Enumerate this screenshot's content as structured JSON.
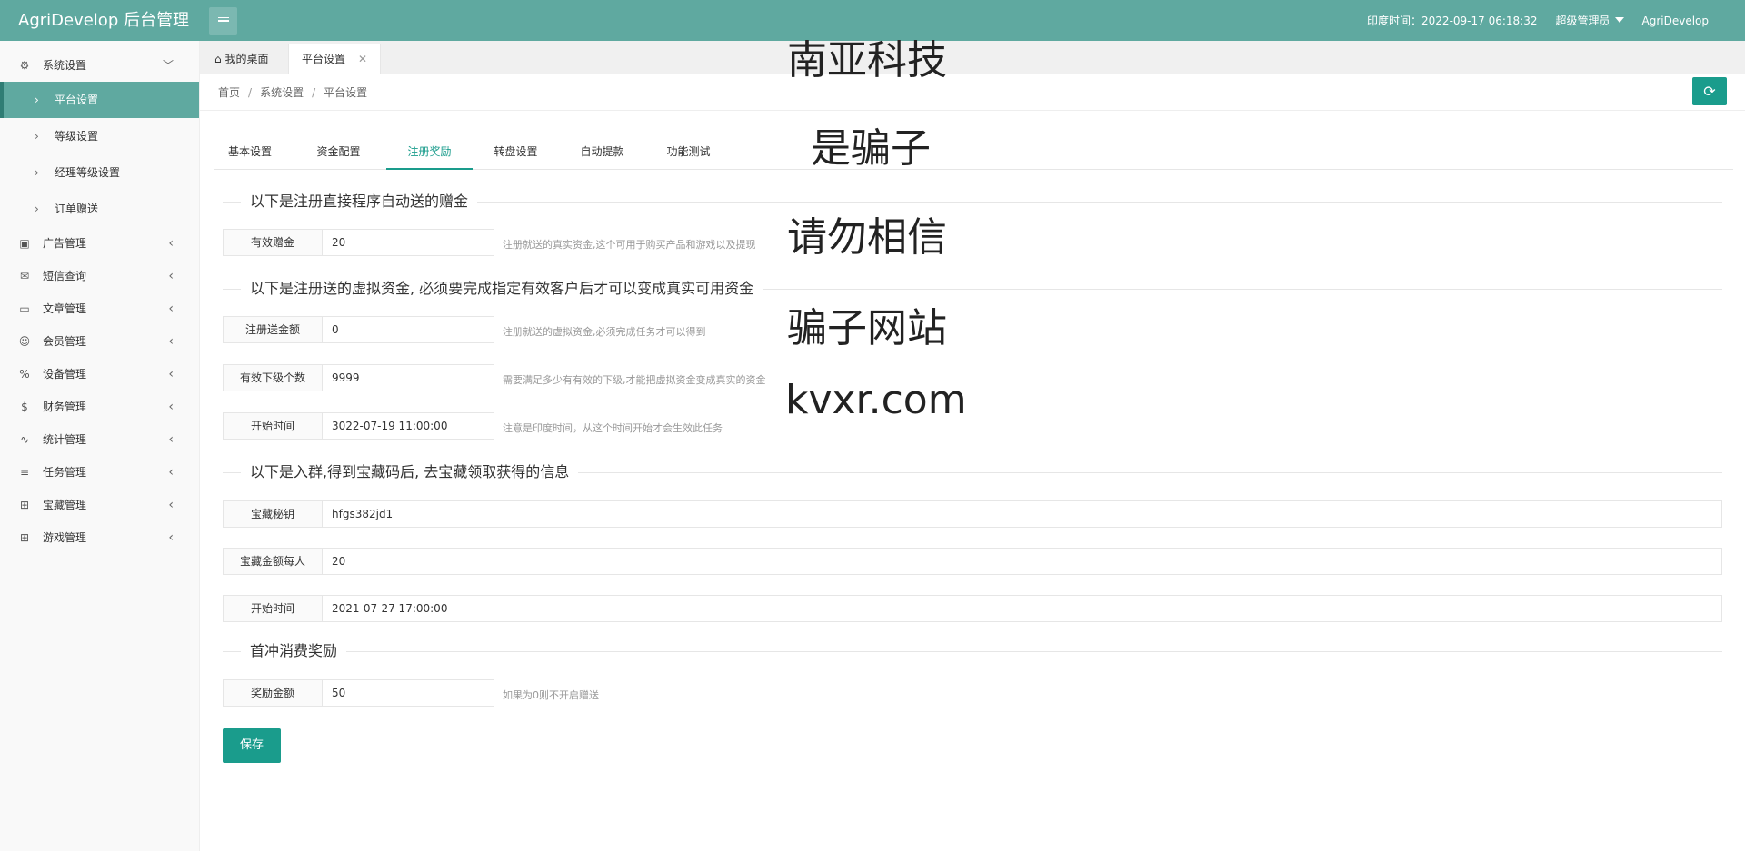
{
  "header": {
    "brand": "AgriDevelop 后台管理",
    "time_label": "印度时间：2022-09-17 06:18:32",
    "role": "超级管理员",
    "username": "AgriDevelop"
  },
  "sidebar": {
    "groups": [
      {
        "label": "系统设置",
        "icon": "gear-icon"
      },
      {
        "label": "广告管理",
        "icon": "image-icon"
      },
      {
        "label": "短信查询",
        "icon": "mail-icon"
      },
      {
        "label": "文章管理",
        "icon": "book-icon"
      },
      {
        "label": "会员管理",
        "icon": "user-icon"
      },
      {
        "label": "设备管理",
        "icon": "percent-icon"
      },
      {
        "label": "财务管理",
        "icon": "dollar-icon"
      },
      {
        "label": "统计管理",
        "icon": "pulse-icon"
      },
      {
        "label": "任务管理",
        "icon": "sliders-icon"
      },
      {
        "label": "宝藏管理",
        "icon": "gift-icon"
      },
      {
        "label": "游戏管理",
        "icon": "gift-icon"
      }
    ],
    "sub_items": [
      "平台设置",
      "等级设置",
      "经理等级设置",
      "订单赠送"
    ]
  },
  "page_tabs": {
    "home": "我的桌面",
    "current": "平台设置"
  },
  "breadcrumb": [
    "首页",
    "系统设置",
    "平台设置"
  ],
  "tabs": [
    "基本设置",
    "资金配置",
    "注册奖励",
    "转盘设置",
    "自动提款",
    "功能测试"
  ],
  "sections": {
    "s1": "以下是注册直接程序自动送的赠金",
    "s2": "以下是注册送的虚拟资金, 必须要完成指定有效客户后才可以变成真实可用资金",
    "s3": "以下是入群,得到宝藏码后, 去宝藏领取获得的信息",
    "s4": "首冲消费奖励"
  },
  "fields": {
    "bonus": {
      "label": "有效赠金",
      "value": "20",
      "hint": "注册就送的真实资金,这个可用于购买产品和游戏以及提现"
    },
    "reg_amount": {
      "label": "注册送金额",
      "value": "0",
      "hint": "注册就送的虚拟资金,必须完成任务才可以得到"
    },
    "sub_count": {
      "label": "有效下级个数",
      "value": "9999",
      "hint": "需要满足多少有有效的下级,才能把虚拟资金变成真实的资金"
    },
    "start_time": {
      "label": "开始时间",
      "value": "3022-07-19 11:00:00",
      "hint": "注意是印度时间，从这个时间开始才会生效此任务"
    },
    "treasure_key": {
      "label": "宝藏秘钥",
      "value": "hfgs382jd1"
    },
    "treasure_amount": {
      "label": "宝藏金额每人",
      "value": "20"
    },
    "treasure_start": {
      "label": "开始时间",
      "value": "2021-07-27 17:00:00"
    },
    "reward_amount": {
      "label": "奖励金额",
      "value": "50",
      "hint": "如果为0则不开启赠送"
    }
  },
  "save_label": "保存",
  "overlay_text": [
    "南亚科技",
    "是骗子",
    "请勿相信",
    "骗子网站",
    "kvxr.com"
  ]
}
